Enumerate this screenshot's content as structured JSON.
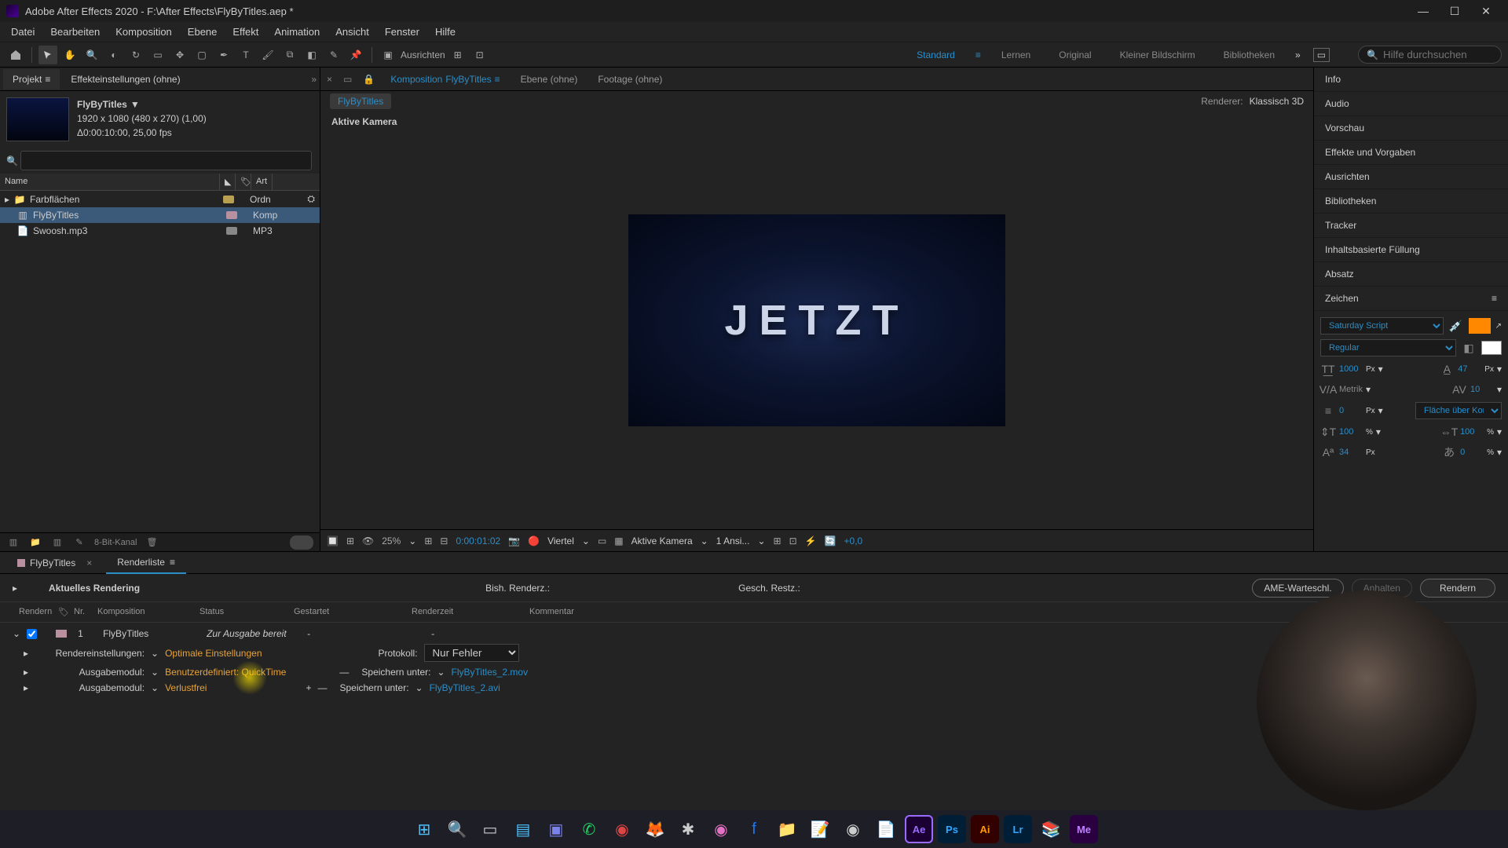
{
  "title": "Adobe After Effects 2020 - F:\\After Effects\\FlyByTitles.aep *",
  "menu": [
    "Datei",
    "Bearbeiten",
    "Komposition",
    "Ebene",
    "Effekt",
    "Animation",
    "Ansicht",
    "Fenster",
    "Hilfe"
  ],
  "toolbar": {
    "snap_label": "Ausrichten",
    "workspaces": [
      "Standard",
      "Lernen",
      "Original",
      "Kleiner Bildschirm",
      "Bibliotheken"
    ],
    "active_workspace": 0,
    "search_placeholder": "Hilfe durchsuchen"
  },
  "project": {
    "tab1": "Projekt",
    "tab2": "Effekteinstellungen (ohne)",
    "comp_name": "FlyByTitles",
    "comp_dims": "1920 x 1080 (480 x 270) (1,00)",
    "comp_dur": "Δ0:00:10:00, 25,00 fps",
    "col_name": "Name",
    "col_type": "Art",
    "items": [
      {
        "name": "Farbflächen",
        "type": "Ordn",
        "kind": "folder"
      },
      {
        "name": "FlyByTitles",
        "type": "Komp",
        "kind": "comp",
        "selected": true
      },
      {
        "name": "Swoosh.mp3",
        "type": "MP3",
        "kind": "audio"
      }
    ],
    "footer_bits": "8-Bit-Kanal"
  },
  "viewer": {
    "tabs": {
      "comp_prefix": "Komposition",
      "comp_name": "FlyByTitles",
      "layer": "Ebene (ohne)",
      "footage": "Footage (ohne)"
    },
    "breadcrumb": "FlyByTitles",
    "renderer_label": "Renderer:",
    "renderer_value": "Klassisch 3D",
    "active_camera": "Aktive Kamera",
    "preview_text": "JETZT",
    "controls": {
      "zoom": "25%",
      "timecode": "0:00:01:02",
      "res": "Viertel",
      "view": "Aktive Kamera",
      "views": "1 Ansi...",
      "offset": "+0,0"
    }
  },
  "right_panels": [
    "Info",
    "Audio",
    "Vorschau",
    "Effekte und Vorgaben",
    "Ausrichten",
    "Bibliotheken",
    "Tracker",
    "Inhaltsbasierte Füllung",
    "Absatz"
  ],
  "char": {
    "title": "Zeichen",
    "font": "Saturday Script",
    "style": "Regular",
    "size": "1000",
    "size_unit": "Px",
    "leading": "47",
    "leading_unit": "Px",
    "kerning": "Metrik",
    "tracking": "10",
    "stroke": "0",
    "stroke_unit": "Px",
    "stroke_mode": "Fläche über Kon...",
    "vscale": "100",
    "vscale_unit": "%",
    "hscale": "100",
    "hscale_unit": "%",
    "baseline": "34",
    "baseline_unit": "Px",
    "tsume": "0",
    "tsume_unit": "%"
  },
  "bottom": {
    "tab_timeline": "FlyByTitles",
    "tab_render": "Renderliste",
    "current_label": "Aktuelles Rendering",
    "prev_label": "Bish. Renderz.:",
    "est_label": "Gesch. Restz.:",
    "btn_ame": "AME-Warteschl.",
    "btn_pause": "Anhalten",
    "btn_render": "Rendern",
    "cols": [
      "Rendern",
      "Nr.",
      "Komposition",
      "Status",
      "Gestartet",
      "Renderzeit",
      "Kommentar"
    ],
    "item": {
      "nr": "1",
      "comp": "FlyByTitles",
      "status": "Zur Ausgabe bereit",
      "started": "-",
      "time": "-"
    },
    "settings_label": "Rendereinstellungen:",
    "settings_value": "Optimale Einstellungen",
    "output1_label": "Ausgabemodul:",
    "output1_value": "Benutzerdefiniert: QuickTime",
    "output2_label": "Ausgabemodul:",
    "output2_value": "Verlustfrei",
    "protocol_label": "Protokoll:",
    "protocol_value": "Nur Fehler",
    "save1_label": "Speichern unter:",
    "save1_value": "FlyByTitles_2.mov",
    "save2_label": "Speichern unter:",
    "save2_value": "FlyByTitles_2.avi"
  }
}
